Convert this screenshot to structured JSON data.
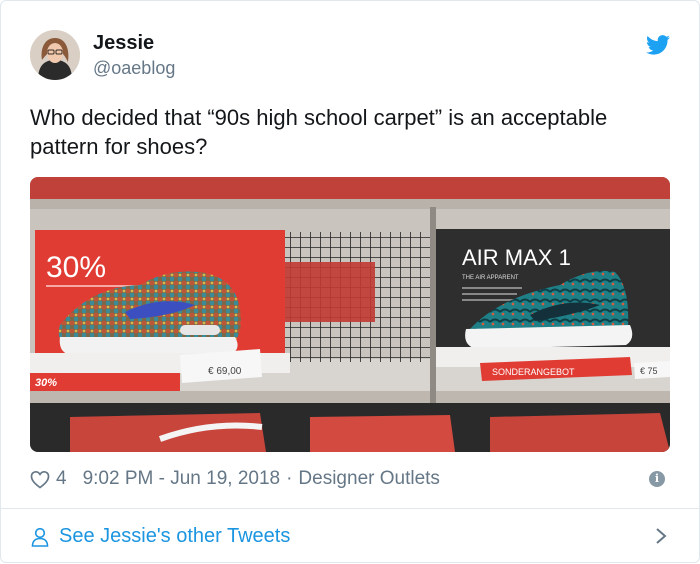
{
  "user": {
    "name": "Jessie",
    "handle": "@oaeblog"
  },
  "tweet": {
    "text": "Who decided that “90s high school carpet” is an acceptable pattern for shoes?"
  },
  "photo": {
    "left_sign": {
      "percent": "30%",
      "band_label": "30%",
      "price": "€ 69,00"
    },
    "right_sign": {
      "title": "AIR MAX 1",
      "subtitle": "THE AIR APPARENT",
      "band_label": "SONDERANGEBOT",
      "price": "€ 75"
    }
  },
  "meta": {
    "likes": "4",
    "timestamp": "9:02 PM - Jun 19, 2018",
    "separator": "·",
    "location": "Designer Outlets"
  },
  "footer": {
    "link_label": "See Jessie's other Tweets"
  },
  "colors": {
    "link": "#1b95e0",
    "secondary_text": "#657786",
    "twitter_blue": "#1da1f2"
  }
}
